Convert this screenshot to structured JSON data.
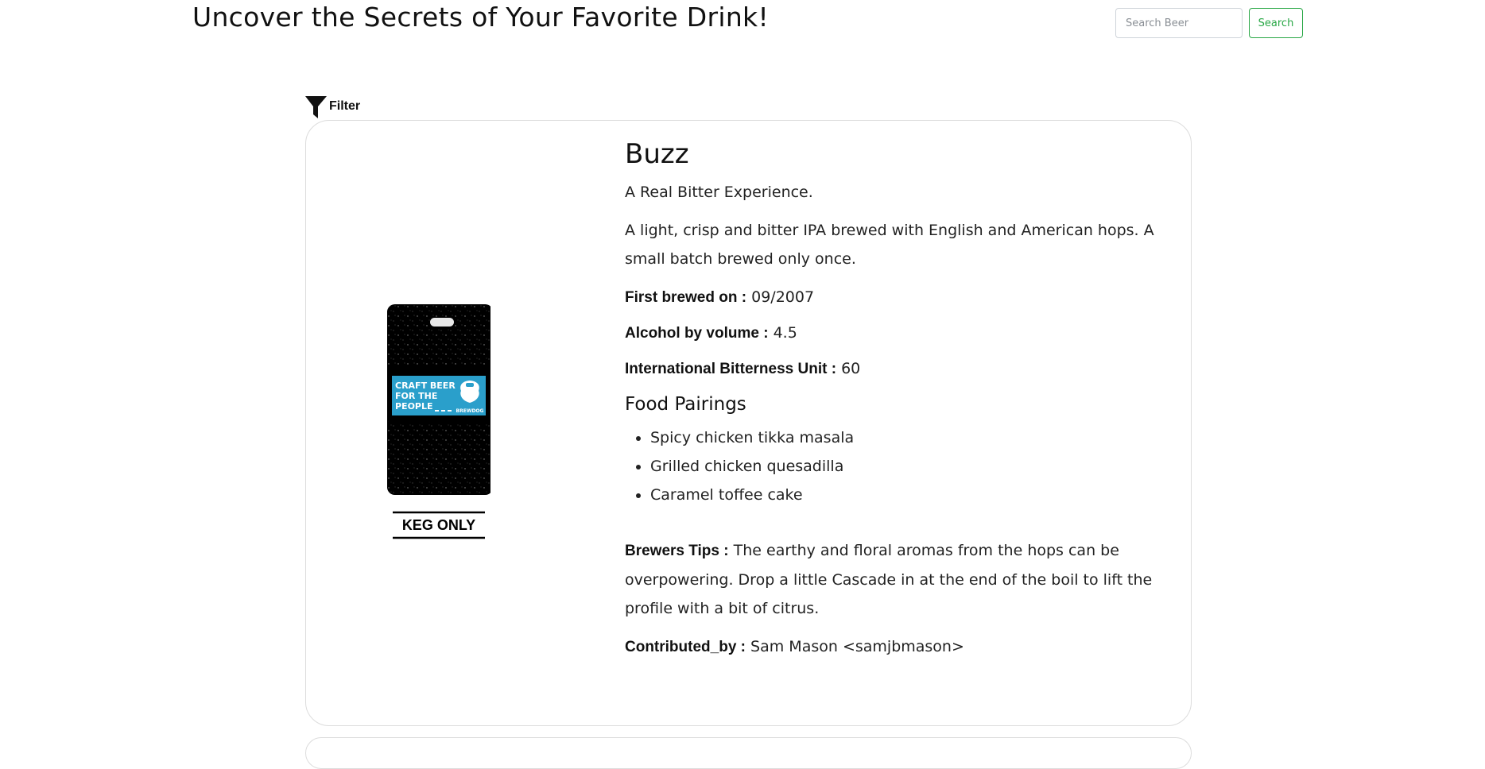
{
  "header": {
    "title": "Uncover the Secrets of Your Favorite Drink!"
  },
  "search": {
    "placeholder": "Search Beer",
    "value": "",
    "button_label": "Search"
  },
  "filter": {
    "label": "Filter",
    "icon": "filter-icon"
  },
  "beer": {
    "image": {
      "badge_text": "CRAFT BEER FOR THE PEOPLE",
      "brand": "BREWDOG",
      "footer_text": "KEG ONLY",
      "colors": {
        "can": "#000000",
        "band": "#2a9fcb"
      }
    },
    "name": "Buzz",
    "tagline": "A Real Bitter Experience.",
    "description": "A light, crisp and bitter IPA brewed with English and American hops. A small batch brewed only once.",
    "first_brewed_label": "First brewed on :",
    "first_brewed": "09/2007",
    "abv_label": "Alcohol by volume :",
    "abv": "4.5",
    "ibu_label": "International Bitterness Unit :",
    "ibu": "60",
    "food_pairings_heading": "Food Pairings",
    "food_pairings": [
      "Spicy chicken tikka masala",
      "Grilled chicken quesadilla",
      "Caramel toffee cake"
    ],
    "brewers_tips_label": "Brewers Tips :",
    "brewers_tips": "The earthy and floral aromas from the hops can be overpowering. Drop a little Cascade in at the end of the boil to lift the profile with a bit of citrus.",
    "contributed_by_label": "Contributed_by :",
    "contributed_by": "Sam Mason <samjbmason>"
  }
}
